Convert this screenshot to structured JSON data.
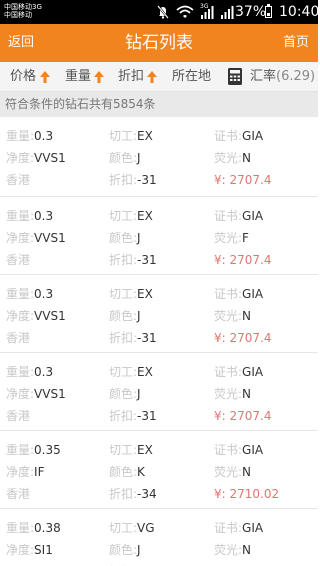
{
  "status_bar": {
    "carrier_1": "中国移动3G",
    "carrier_2": "中国移动",
    "carrier_tag": "3G",
    "battery": "37%",
    "time": "10:40",
    "icons": [
      "mute-icon",
      "wifi-icon",
      "signal-3g-icon",
      "signal-icon"
    ]
  },
  "title_bar": {
    "back": "返回",
    "title": "钻石列表",
    "home": "首页",
    "background_color": "#f1841e"
  },
  "filters": {
    "price": "价格",
    "weight": "重量",
    "discount": "折扣",
    "location": "所在地",
    "rate_label": "汇率",
    "rate_value": "(6.29)",
    "arrow_color": "#f1841e"
  },
  "result_count": "符合条件的钻石共有5854条",
  "labels": {
    "weight": "重量:",
    "clarity": "净度:",
    "cut": "切工:",
    "color": "颜色:",
    "discount": "折扣:",
    "cert": "证书:",
    "fluorescence": "荧光:"
  },
  "items": [
    {
      "weight": "0.3",
      "clarity": "VVS1",
      "location": "香港",
      "cut": "EX",
      "color": "J",
      "discount": "-31",
      "cert": "GIA",
      "fluorescence": "N",
      "price": "¥: 2707.4"
    },
    {
      "weight": "0.3",
      "clarity": "VVS1",
      "location": "香港",
      "cut": "EX",
      "color": "J",
      "discount": "-31",
      "cert": "GIA",
      "fluorescence": "F",
      "price": "¥: 2707.4"
    },
    {
      "weight": "0.3",
      "clarity": "VVS1",
      "location": "香港",
      "cut": "EX",
      "color": "J",
      "discount": "-31",
      "cert": "GIA",
      "fluorescence": "N",
      "price": "¥: 2707.4"
    },
    {
      "weight": "0.3",
      "clarity": "VVS1",
      "location": "香港",
      "cut": "EX",
      "color": "J",
      "discount": "-31",
      "cert": "GIA",
      "fluorescence": "N",
      "price": "¥: 2707.4"
    },
    {
      "weight": "0.35",
      "clarity": "IF",
      "location": "香港",
      "cut": "EX",
      "color": "K",
      "discount": "-34",
      "cert": "GIA",
      "fluorescence": "N",
      "price": "¥: 2710.02"
    },
    {
      "weight": "0.38",
      "clarity": "SI1",
      "location": "",
      "cut": "VG",
      "color": "J",
      "discount": "",
      "cert": "GIA",
      "fluorescence": "N",
      "price": ""
    }
  ]
}
